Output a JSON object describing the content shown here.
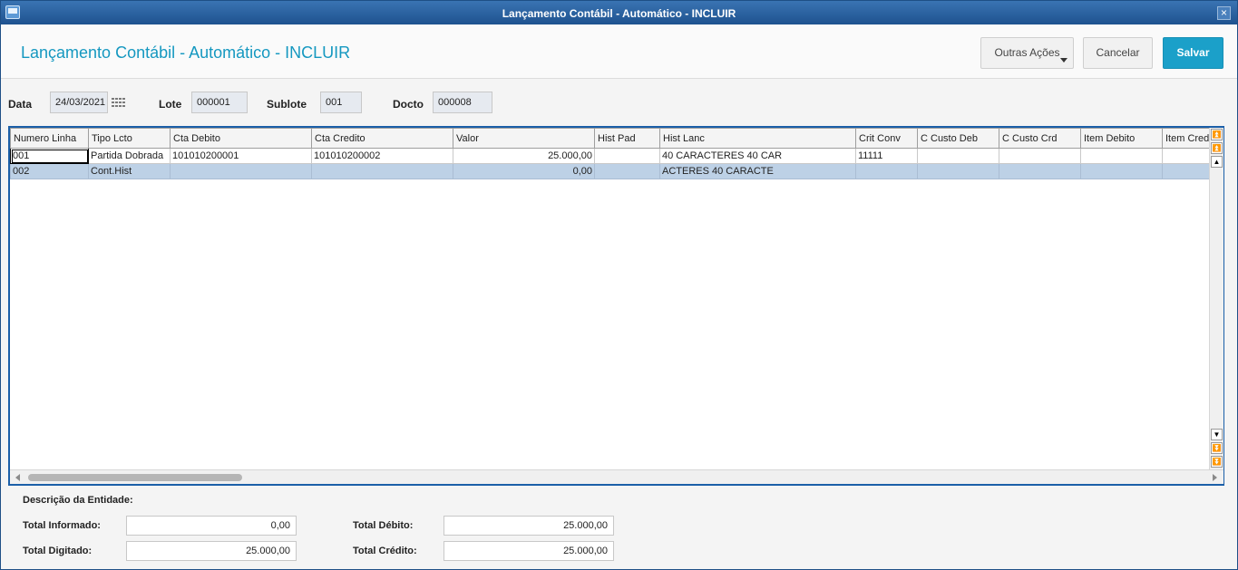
{
  "window": {
    "title": "Lançamento Contábil - Automático - INCLUIR",
    "close_label": "×"
  },
  "header": {
    "title": "Lançamento Contábil - Automático - INCLUIR",
    "more_actions_label": "Outras Ações",
    "cancel_label": "Cancelar",
    "save_label": "Salvar"
  },
  "fields": {
    "data_label": "Data",
    "data_value": "24/03/2021",
    "lote_label": "Lote",
    "lote_value": "000001",
    "sublote_label": "Sublote",
    "sublote_value": "001",
    "docto_label": "Docto",
    "docto_value": "000008"
  },
  "grid": {
    "columns": [
      "Numero Linha",
      "Tipo Lcto",
      "Cta Debito",
      "Cta Credito",
      "Valor",
      "Hist Pad",
      "Hist Lanc",
      "Crit Conv",
      "C Custo Deb",
      "C Custo Crd",
      "Item Debito",
      "Item Credito"
    ],
    "rows": [
      [
        "001",
        "Partida Dobrada",
        "101010200001",
        "101010200002",
        "25.000,00",
        "",
        "40 CARACTERES 40 CAR",
        "11111",
        "",
        "",
        "",
        ""
      ],
      [
        "002",
        "Cont.Hist",
        "",
        "",
        "0,00",
        "",
        "ACTERES 40 CARACTE",
        "",
        "",
        "",
        "",
        ""
      ]
    ]
  },
  "footer": {
    "description_label": "Descrição da Entidade:",
    "total_informado_label": "Total Informado:",
    "total_informado": "0,00",
    "total_digitado_label": "Total Digitado:",
    "total_digitado": "25.000,00",
    "total_debito_label": "Total Débito:",
    "total_debito": "25.000,00",
    "total_credito_label": "Total Crédito:",
    "total_credito": "25.000,00"
  },
  "colors": {
    "accent": "#1ba0c9",
    "titlebar": "#1e528f",
    "selected_row": "#bdd1e6"
  },
  "icons": {
    "calendar": "calendar-icon",
    "app": "window-app-icon"
  }
}
